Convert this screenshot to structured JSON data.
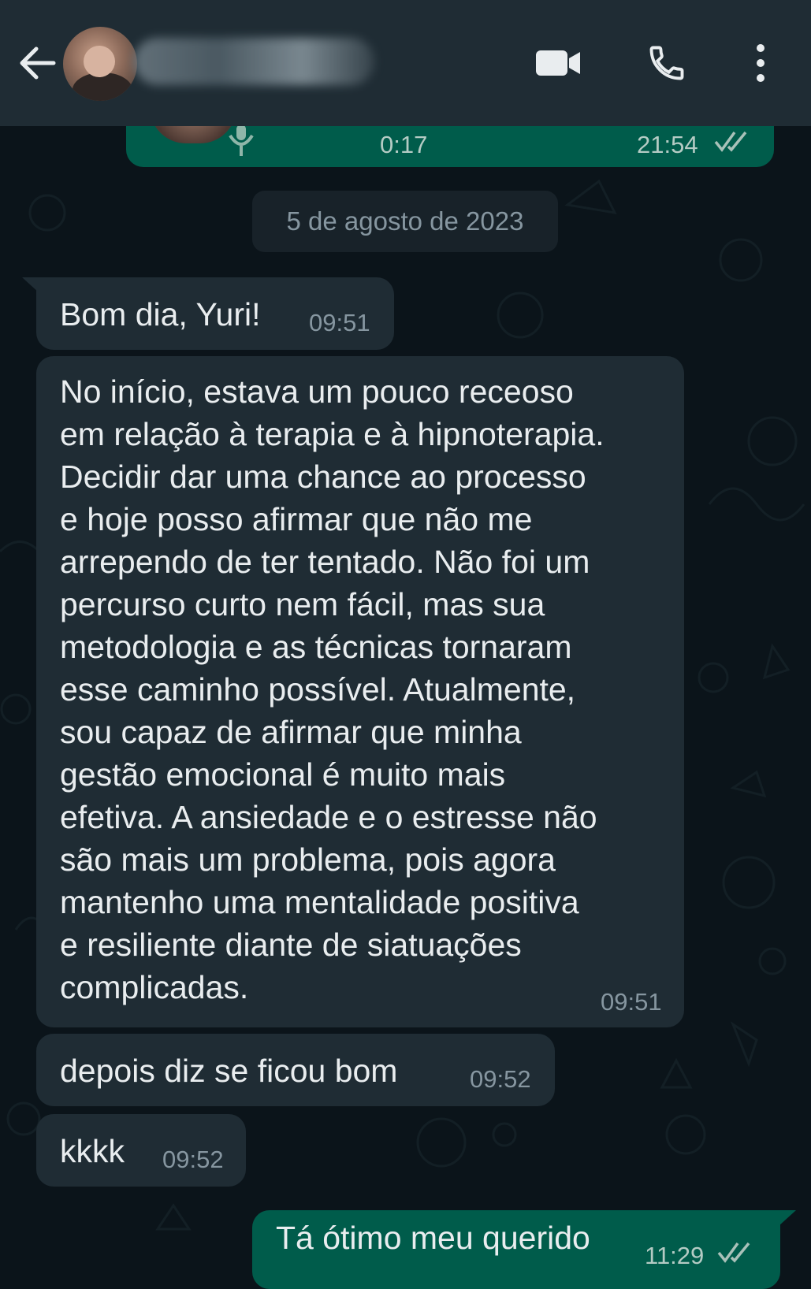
{
  "header": {
    "contact_name": "",
    "icons": [
      "back-arrow-icon",
      "video-call-icon",
      "voice-call-icon",
      "more-options-icon"
    ]
  },
  "audio_message": {
    "duration": "0:17",
    "time": "21:54",
    "status": "read",
    "icons": [
      "microphone-icon",
      "double-check-icon"
    ]
  },
  "date_separator": "5 de agosto de 2023",
  "messages": [
    {
      "direction": "incoming",
      "text": "Bom dia, Yuri!",
      "time": "09:51"
    },
    {
      "direction": "incoming",
      "text": "No início, estava um pouco receoso\nem relação à terapia e à hipnoterapia.\nDecidir dar uma chance ao processo\ne hoje posso afirmar que não me\narrependo de ter tentado. Não foi um\npercurso curto nem fácil, mas sua\nmetodologia e as técnicas tornaram\nesse caminho possível. Atualmente,\nsou capaz de afirmar que minha\ngestão emocional é muito mais\nefetiva. A ansiedade e o estresse não\nsão mais um problema, pois agora\nmantenho uma mentalidade positiva\ne resiliente diante de siatuações\ncomplicadas.",
      "time": "09:51"
    },
    {
      "direction": "incoming",
      "text": "depois diz se ficou bom",
      "time": "09:52"
    },
    {
      "direction": "incoming",
      "text": "kkkk",
      "time": "09:52"
    },
    {
      "direction": "outgoing",
      "text": "Tá ótimo meu querido",
      "time": "11:29"
    }
  ],
  "colors": {
    "header_bg": "#1f2c34",
    "chat_bg": "#0b141a",
    "incoming_bubble": "#1f2c34",
    "outgoing_bubble": "#005c4b",
    "read_ticks": "#8696a0"
  }
}
